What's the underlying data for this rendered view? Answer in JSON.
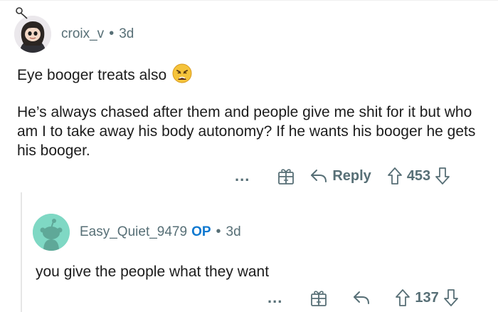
{
  "comments": [
    {
      "username": "croix_v",
      "separator": "•",
      "age": "3d",
      "paragraphs": [
        "Eye booger treats also",
        "He’s always chased after them and people give me shit for it but who am I to take away his body autonomy? If he wants his booger he gets his booger."
      ],
      "emoji": "weary-face-emoji",
      "more": "...",
      "reply_label": "Reply",
      "score": "453"
    },
    {
      "username": "Easy_Quiet_9479",
      "op_badge": "OP",
      "separator": "•",
      "age": "3d",
      "paragraphs": [
        "you give the people what they want"
      ],
      "more": "...",
      "score": "137"
    }
  ],
  "icons": [
    "avatar-croix",
    "avatar-snoo",
    "gift-icon",
    "reply-arrow-icon",
    "upvote-icon",
    "downvote-icon"
  ],
  "colors": {
    "meta": "#576f76",
    "op": "#0f79d0",
    "avatar_bg": "#7fd8c4",
    "emoji": "#f5c33b"
  }
}
